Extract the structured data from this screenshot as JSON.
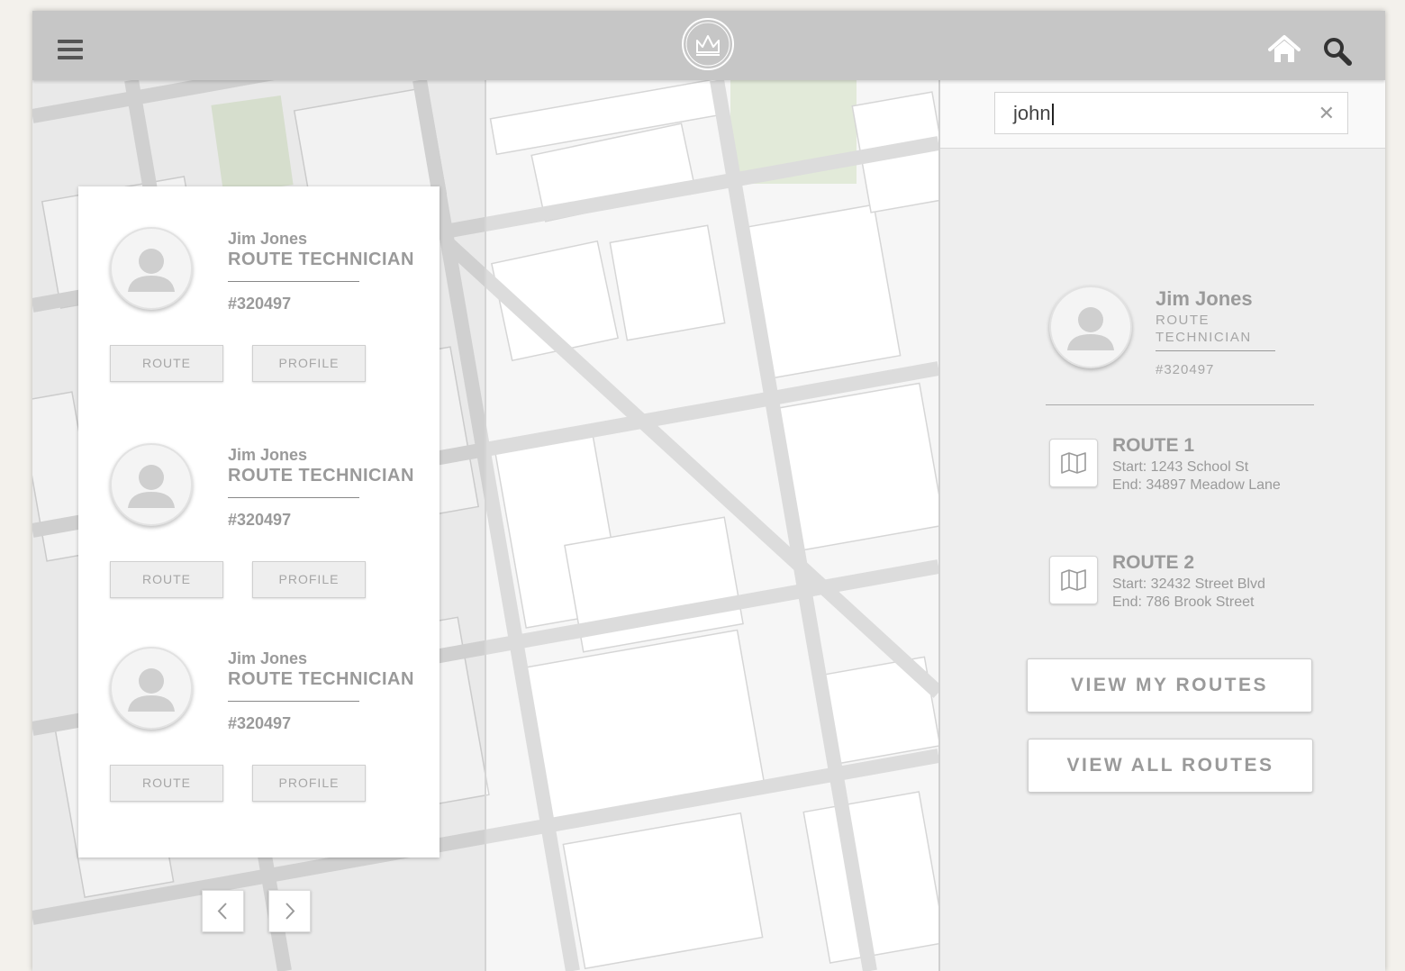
{
  "header": {
    "menu_icon": "hamburger-menu-icon",
    "logo": "crown-logo",
    "home_icon": "home-icon",
    "search_icon": "search-icon"
  },
  "employees": [
    {
      "name": "Jim Jones",
      "role": "ROUTE TECHNICIAN",
      "id": "#320497",
      "route_label": "ROUTE",
      "profile_label": "PROFILE"
    },
    {
      "name": "Jim Jones",
      "role": "ROUTE TECHNICIAN",
      "id": "#320497",
      "route_label": "ROUTE",
      "profile_label": "PROFILE"
    },
    {
      "name": "Jim Jones",
      "role": "ROUTE TECHNICIAN",
      "id": "#320497",
      "route_label": "ROUTE",
      "profile_label": "PROFILE"
    }
  ],
  "pagination": {
    "prev_icon": "chevron-left-icon",
    "next_icon": "chevron-right-icon"
  },
  "search": {
    "value": "john",
    "clear_icon": "close-icon"
  },
  "selected": {
    "name": "Jim Jones",
    "role": "ROUTE TECHNICIAN",
    "id": "#320497",
    "routes": [
      {
        "title": "ROUTE 1",
        "start": "Start: 1243 School St",
        "end": "End: 34897 Meadow Lane"
      },
      {
        "title": "ROUTE 2",
        "start": "Start: 32432 Street Blvd",
        "end": "End: 786 Brook Street"
      }
    ],
    "view_my_routes": "VIEW MY ROUTES",
    "view_all_routes": "VIEW ALL ROUTES"
  },
  "colors": {
    "topbar": "#c6c6c6",
    "text_muted": "#9a9a9a",
    "park": "#e2ead9"
  }
}
